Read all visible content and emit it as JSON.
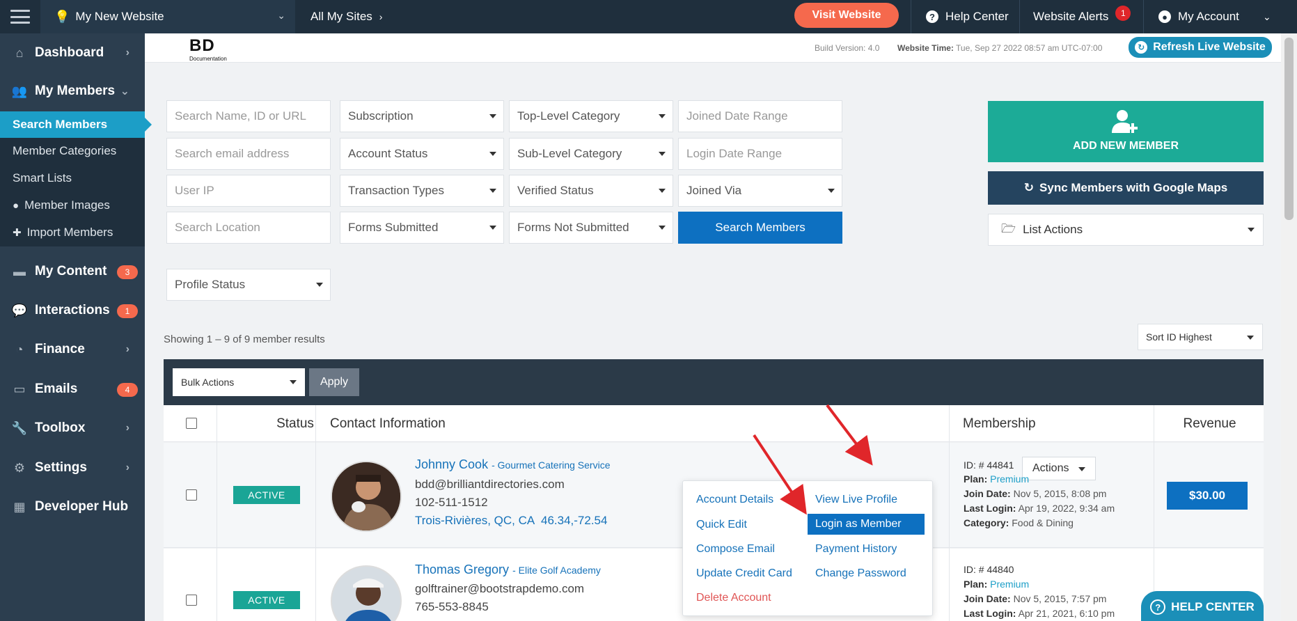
{
  "topbar": {
    "site_name": "My New Website",
    "all_sites": "All My Sites",
    "visit_website": "Visit Website",
    "help_center": "Help Center",
    "website_alerts": "Website Alerts",
    "alerts_count": "1",
    "my_account": "My Account"
  },
  "sidebar": {
    "items": [
      {
        "label": "Dashboard",
        "icon": "home-icon"
      },
      {
        "label": "My Members",
        "icon": "users-icon"
      },
      {
        "label": "My Content",
        "icon": "folder-icon",
        "badge": "3"
      },
      {
        "label": "Interactions",
        "icon": "chat-icon",
        "badge": "1"
      },
      {
        "label": "Finance",
        "icon": "pie-chart-icon"
      },
      {
        "label": "Emails",
        "icon": "inbox-icon",
        "badge": "4"
      },
      {
        "label": "Toolbox",
        "icon": "wrench-icon"
      },
      {
        "label": "Settings",
        "icon": "gear-icon"
      },
      {
        "label": "Developer Hub",
        "icon": "grid-icon"
      }
    ],
    "submenu": [
      "Search Members",
      "Member Categories",
      "Smart Lists",
      "Member Images",
      "Import Members"
    ]
  },
  "header": {
    "logo_big": "BD",
    "logo_small": "Documentation",
    "build_version": "Build Version: 4.0",
    "website_time_label": "Website Time:",
    "website_time_value": "Tue, Sep 27 2022 08:57 am UTC-07:00",
    "refresh_label": "Refresh Live Website"
  },
  "filters": {
    "search_name": "Search Name, ID or URL",
    "subscription": "Subscription",
    "top_category": "Top-Level Category",
    "joined_date": "Joined Date Range",
    "search_email": "Search email address",
    "account_status": "Account Status",
    "sub_category": "Sub-Level Category",
    "login_date": "Login Date Range",
    "user_ip": "User IP",
    "transaction_types": "Transaction Types",
    "verified_status": "Verified Status",
    "joined_via": "Joined Via",
    "search_location": "Search Location",
    "forms_submitted": "Forms Submitted",
    "forms_not_submitted": "Forms Not Submitted",
    "search_button": "Search Members",
    "profile_status": "Profile Status"
  },
  "actions_panel": {
    "add_member": "ADD NEW MEMBER",
    "sync_maps": "Sync Members with Google Maps",
    "list_actions": "List Actions"
  },
  "results": {
    "showing": "Showing 1 – 9 of 9 member results",
    "sort": "Sort ID Highest",
    "bulk_actions": "Bulk Actions",
    "apply": "Apply"
  },
  "table": {
    "headers": [
      "Status",
      "Contact Information",
      "Membership",
      "Revenue"
    ],
    "rows": [
      {
        "status": "ACTIVE",
        "name": "Johnny Cook",
        "business": "- Gourmet Catering Service",
        "email": "bdd@brilliantdirectories.com",
        "phone": "102-511-1512",
        "location": "Trois-Rivières, QC, CA",
        "coords": "46.34,-72.54",
        "actions_label": "Actions",
        "id": "ID: # 44841",
        "plan_label": "Plan:",
        "plan": "Premium",
        "join_label": "Join Date:",
        "join_date": "Nov 5, 2015, 8:08 pm",
        "login_label": "Last Login:",
        "last_login": "Apr 19, 2022, 9:34 am",
        "category_label": "Category:",
        "category": "Food & Dining",
        "revenue": "$30.00"
      },
      {
        "status": "ACTIVE",
        "name": "Thomas Gregory",
        "business": "- Elite Golf Academy",
        "email": "golftrainer@bootstrapdemo.com",
        "phone": "765-553-8845",
        "id": "ID: # 44840",
        "plan_label": "Plan:",
        "plan": "Premium",
        "join_label": "Join Date:",
        "join_date": "Nov 5, 2015, 7:57 pm",
        "login_label": "Last Login:",
        "last_login": "Apr 21, 2021, 6:10 pm"
      }
    ]
  },
  "dropdown": {
    "account_details": "Account Details",
    "view_live_profile": "View Live Profile",
    "quick_edit": "Quick Edit",
    "login_as_member": "Login as Member",
    "compose_email": "Compose Email",
    "payment_history": "Payment History",
    "update_credit_card": "Update Credit Card",
    "change_password": "Change Password",
    "delete_account": "Delete Account"
  },
  "help_fab": "HELP CENTER",
  "colors": {
    "accent_blue": "#0d70c1",
    "teal": "#1cab97",
    "orange": "#f5694d",
    "sidebar": "#2c3e4f",
    "annotation_arrow": "#e0262a"
  }
}
